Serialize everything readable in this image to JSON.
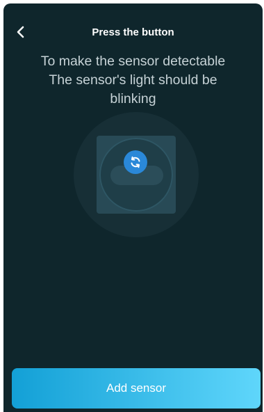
{
  "header": {
    "title": "Press the button",
    "back_icon": "chevron-left-icon"
  },
  "instructions": {
    "line1": "To make the sensor detectable",
    "line2": "The sensor's light should be",
    "line3": "blinking"
  },
  "illustration": {
    "button_icon": "sync-icon",
    "button_color": "#2a88d8"
  },
  "footer": {
    "add_label": "Add sensor"
  },
  "colors": {
    "background": "#0f262c",
    "accent_start": "#13a0d6",
    "accent_end": "#5fd6fb"
  }
}
